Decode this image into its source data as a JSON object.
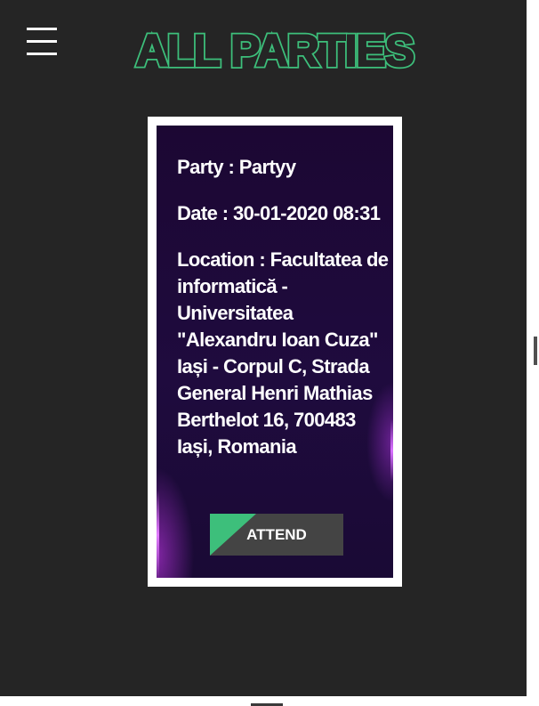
{
  "header": {
    "menu_icon": "hamburger-menu-icon",
    "logo_text": "ALL PARTIES"
  },
  "card": {
    "party_line": "Party : Partyy",
    "date_line": "Date : 30-01-2020 08:31",
    "location_line": "Location : Facultatea de informatică - Universitatea \"Alexandru Ioan Cuza\" Iași - Corpul C, Strada General Henri Mathias Berthelot 16, 700483 Iași, Romania",
    "attend_label": "ATTEND"
  },
  "colors": {
    "page_background": "#252525",
    "logo_green": "#3dbf7b",
    "card_background": "#1d0a37",
    "button_background": "#444444",
    "button_accent": "#3dbf7b"
  }
}
